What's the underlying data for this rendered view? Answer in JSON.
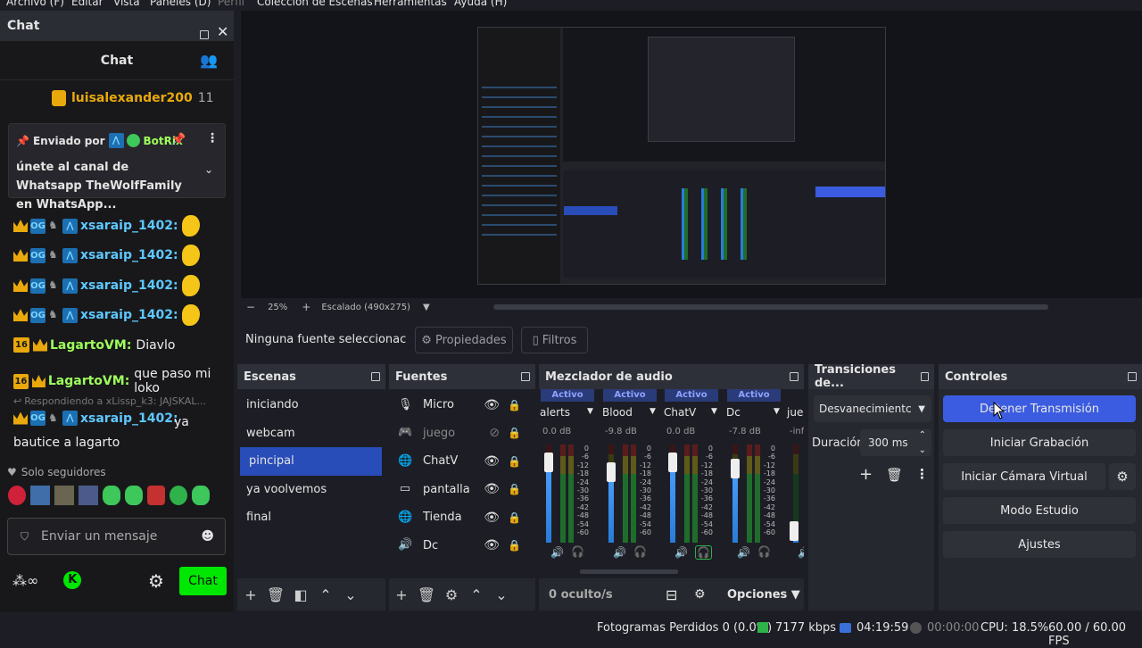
{
  "menu": [
    "Archivo (F)",
    "Editar",
    "Vista",
    "Paneles (D)",
    "Perfil",
    "Colección de Escenas",
    "Herramientas",
    "Ayuda (H)"
  ],
  "chat": {
    "dock_title": "Chat",
    "header": "Chat",
    "top_user": "luisalexander200",
    "top_count": "11",
    "pinned_prefix": "Enviado por",
    "pinned_by": "BotRix",
    "pinned_text": "únete al canal de Whatsapp TheWolfFamily en WhatsApp...",
    "lines": [
      {
        "user": "xsaraip_1402:",
        "msg": ""
      },
      {
        "user": "xsaraip_1402:",
        "msg": ""
      },
      {
        "user": "xsaraip_1402:",
        "msg": ""
      },
      {
        "user": "xsaraip_1402:",
        "msg": ""
      }
    ],
    "lagarto1_user": "LagartoVM:",
    "lagarto1_msg": "Diavlo",
    "lagarto2_user": "LagartoVM:",
    "lagarto2_msg": "que paso mi loko",
    "badge_num": "16",
    "reply_prefix": "Respondiendo a xLissp_k3: JAJSKAL...",
    "reply_user": "xsaraip_1402:",
    "reply_msg": "ya bautice a lagarto",
    "followers_only": "Solo seguidores",
    "input_placeholder": "Enviar un mensaje",
    "send_label": "Chat"
  },
  "zoom": {
    "percent": "25%",
    "scale_label": "Escalado (490x275)"
  },
  "source_bar": {
    "none_selected": "Ninguna fuente seleccionac",
    "properties": "Propiedades",
    "filters": "Filtros"
  },
  "scenes": {
    "title": "Escenas",
    "items": [
      "iniciando",
      "webcam",
      "pincipal",
      "ya voolvemos",
      "final"
    ],
    "selected_index": 2
  },
  "sources": {
    "title": "Fuentes",
    "items": [
      {
        "name": "Micro",
        "icon": "mic-icon",
        "hidden": false
      },
      {
        "name": "juego",
        "icon": "gamepad-icon",
        "hidden": true
      },
      {
        "name": "ChatV",
        "icon": "globe-icon",
        "hidden": false
      },
      {
        "name": "pantalla",
        "icon": "monitor-icon",
        "hidden": false
      },
      {
        "name": "Tienda",
        "icon": "globe-icon",
        "hidden": false
      },
      {
        "name": "Dc",
        "icon": "speaker-icon",
        "hidden": false
      }
    ]
  },
  "mixer": {
    "title": "Mezclador de audio",
    "active_label": "Activo",
    "channels": [
      {
        "name": "alerts",
        "db": "0.0 dB",
        "level": 0.85
      },
      {
        "name": "Blood",
        "db": "-9.8 dB",
        "level": 0.75
      },
      {
        "name": "ChatV",
        "db": "0.0 dB",
        "level": 0.85
      },
      {
        "name": "Dc",
        "db": "-7.8 dB",
        "level": 0.78
      },
      {
        "name": "jueg",
        "db": "-inf",
        "level": 0.15
      }
    ],
    "scale": [
      "0",
      "-6",
      "-12",
      "-18",
      "-24",
      "-30",
      "-36",
      "-42",
      "-48",
      "-54",
      "-60"
    ],
    "hidden_count": "0 oculto/s",
    "options": "Opciones"
  },
  "transitions": {
    "title": "Transiciones de...",
    "selected": "Desvanecimientc",
    "duration_label": "Duración",
    "duration_value": "300 ms"
  },
  "controls": {
    "title": "Controles",
    "stop_stream": "Detener Transmisión",
    "start_record": "Iniciar Grabación",
    "start_virtual_cam": "Iniciar Cámara Virtual",
    "studio_mode": "Modo Estudio",
    "settings": "Ajustes"
  },
  "status": {
    "dropped": "Fotogramas Perdidos 0 (0.0%)",
    "bitrate": "7177 kbps",
    "stream_time": "04:19:59",
    "record_time": "00:00:00",
    "cpu": "CPU: 18.5%",
    "fps": "60.00 / 60.00 FPS"
  },
  "colors": {
    "accent": "#284cb8",
    "stream_active": "#3b5ce0",
    "chat_green": "#00e701"
  }
}
